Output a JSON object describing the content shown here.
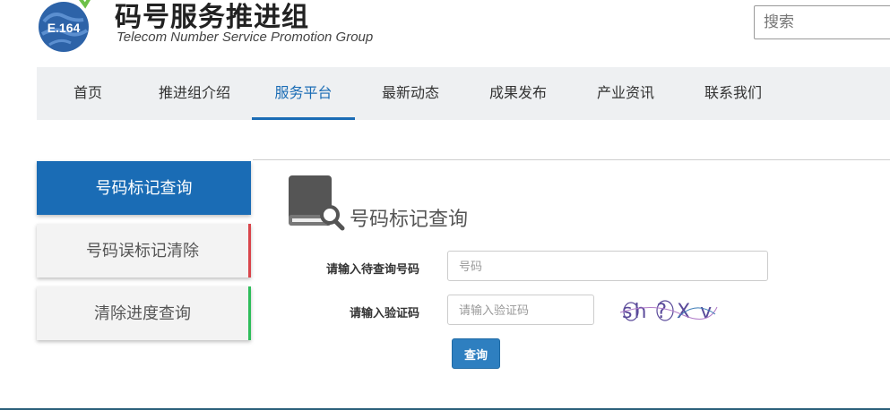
{
  "header": {
    "logo_text": "E.164",
    "title": "码号服务推进组",
    "subtitle": "Telecom Number Service  Promotion Group",
    "search_placeholder": "搜索"
  },
  "nav": {
    "items": [
      {
        "label": "首页"
      },
      {
        "label": "推进组介绍"
      },
      {
        "label": "服务平台",
        "active": true
      },
      {
        "label": "最新动态"
      },
      {
        "label": "成果发布"
      },
      {
        "label": "产业资讯"
      },
      {
        "label": "联系我们"
      }
    ]
  },
  "sidebar": {
    "items": [
      {
        "label": "号码标记查询",
        "active": true
      },
      {
        "label": "号码误标记清除",
        "accent": "#d9454b"
      },
      {
        "label": "清除进度查询",
        "accent": "#2ebd5a"
      }
    ]
  },
  "main": {
    "section_title": "号码标记查询",
    "phone_label": "请输入待查询号码",
    "phone_placeholder": "号码",
    "captcha_label": "请输入验证码",
    "captcha_placeholder": "请输入验证码",
    "captcha_text": "sh ? X v",
    "query_button": "查询"
  },
  "colors": {
    "primary": "#1a6cb5",
    "nav_bg": "#eef0f2",
    "button": "#2e7fc0"
  }
}
